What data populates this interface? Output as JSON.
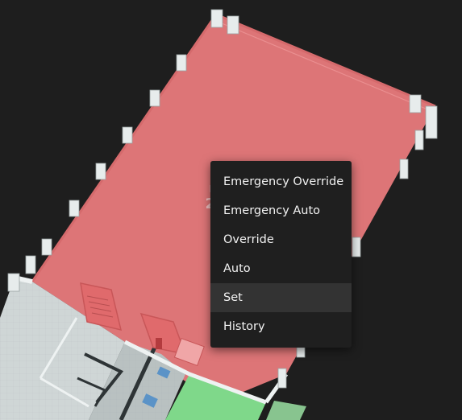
{
  "room": {
    "name": "Ro",
    "value": "25"
  },
  "context_menu": {
    "items": [
      {
        "label": "Emergency Override",
        "highlighted": false
      },
      {
        "label": "Emergency Auto",
        "highlighted": false
      },
      {
        "label": "Override",
        "highlighted": false
      },
      {
        "label": "Auto",
        "highlighted": false
      },
      {
        "label": "Set",
        "highlighted": true
      },
      {
        "label": "History",
        "highlighted": false
      }
    ]
  },
  "colors": {
    "background": "#1e1e1e",
    "room_selected": "#e87a7c",
    "room_adjacent": "#7fd88a",
    "wall": "#dfe4e4",
    "menu_background": "#1f1f1f",
    "menu_highlight": "#333333",
    "menu_text": "#f2f2f2"
  }
}
